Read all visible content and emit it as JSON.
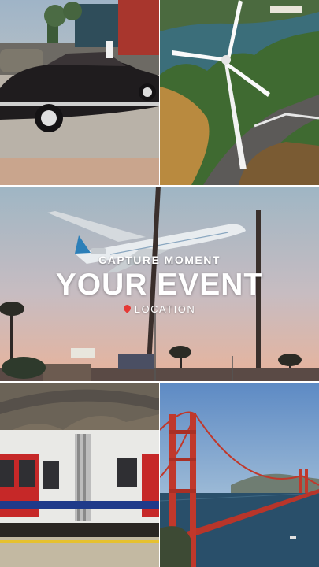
{
  "overlay": {
    "tagline": "CAPTURE MOMENT",
    "headline": "YOUR EVENT",
    "location": "LOCATION",
    "pin_icon": "location-pin-icon"
  },
  "sign_text": "",
  "colors": {
    "accent_pin": "#e53935",
    "sky_dusk": "#e7b8a3",
    "bridge_red": "#c0382b",
    "train_red": "#c62828"
  }
}
